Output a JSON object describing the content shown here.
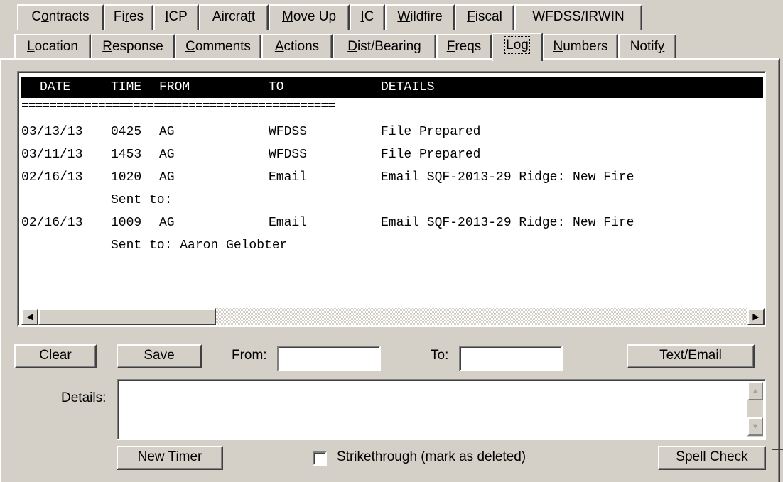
{
  "tabs_row1": [
    {
      "id": "contracts",
      "pre": "C",
      "acc": "o",
      "post": "ntracts"
    },
    {
      "id": "fires",
      "pre": "Fi",
      "acc": "r",
      "post": "es"
    },
    {
      "id": "icp",
      "pre": "",
      "acc": "I",
      "post": "CP"
    },
    {
      "id": "aircraft",
      "pre": "Aircra",
      "acc": "f",
      "post": "t"
    },
    {
      "id": "move-up",
      "pre": "",
      "acc": "M",
      "post": "ove Up"
    },
    {
      "id": "ic",
      "pre": "",
      "acc": "I",
      "post": "C"
    },
    {
      "id": "wildfire",
      "pre": "",
      "acc": "W",
      "post": "ildfire"
    },
    {
      "id": "fiscal",
      "pre": "",
      "acc": "F",
      "post": "iscal"
    },
    {
      "id": "wfdss-irwin",
      "pre": "WFDSS/IRWIN",
      "acc": "",
      "post": ""
    }
  ],
  "tabs_row2": [
    {
      "id": "location",
      "pre": "",
      "acc": "L",
      "post": "ocation"
    },
    {
      "id": "response",
      "pre": "",
      "acc": "R",
      "post": "esponse"
    },
    {
      "id": "comments",
      "pre": "",
      "acc": "C",
      "post": "omments"
    },
    {
      "id": "actions",
      "pre": "",
      "acc": "A",
      "post": "ctions"
    },
    {
      "id": "dist-bearing",
      "pre": "",
      "acc": "D",
      "post": "ist/Bearing"
    },
    {
      "id": "freqs",
      "pre": "",
      "acc": "F",
      "post": "reqs"
    },
    {
      "id": "log",
      "pre": "Lo",
      "acc": "g",
      "post": ""
    },
    {
      "id": "numbers",
      "pre": "",
      "acc": "N",
      "post": "umbers"
    },
    {
      "id": "notify",
      "pre": "Notif",
      "acc": "y",
      "post": ""
    }
  ],
  "active_tab": "log",
  "log": {
    "headers": {
      "date": "DATE",
      "time": "TIME",
      "from": "FROM",
      "to": "TO",
      "details": "DETAILS"
    },
    "separator": "=============================================",
    "lines": [
      {
        "date": "03/13/13",
        "time": "0425",
        "from": "AG",
        "to": "WFDSS",
        "details": "File Prepared"
      },
      {
        "date": "03/11/13",
        "time": "1453",
        "from": "AG",
        "to": "WFDSS",
        "details": "File Prepared"
      },
      {
        "date": "02/16/13",
        "time": "1020",
        "from": "AG",
        "to": "Email",
        "details": "Email SQF-2013-29 Ridge: New Fire"
      },
      {
        "date": "",
        "time": "Sent to:",
        "from": "",
        "to": "",
        "details": ""
      },
      {
        "date": "02/16/13",
        "time": "1009",
        "from": "AG",
        "to": "Email",
        "details": "Email SQF-2013-29 Ridge: New Fire"
      },
      {
        "date": "",
        "time": "Sent to: Aaron Gelobter",
        "from": "",
        "to": "",
        "details": ""
      }
    ]
  },
  "controls": {
    "clear_label": "Clear",
    "save_label": "Save",
    "from_label": "From:",
    "from_value": "",
    "to_label": "To:",
    "to_value": "",
    "text_email_label": "Text/Email",
    "details_label": "Details:",
    "details_value": "",
    "new_timer_label": "New Timer",
    "strikethrough_label": "Strikethrough (mark as deleted)",
    "strikethrough_checked": false,
    "spell_check_label": "Spell Check"
  },
  "icons": {
    "scroll_left": "scroll-left-arrow-icon",
    "scroll_right": "scroll-right-arrow-icon",
    "scroll_up": "scroll-up-arrow-icon",
    "scroll_down": "scroll-down-arrow-icon"
  }
}
